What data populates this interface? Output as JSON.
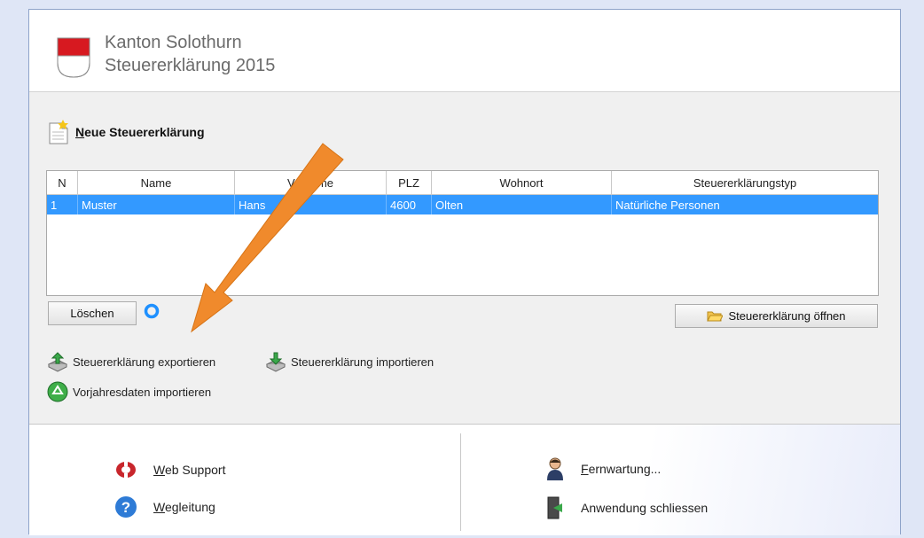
{
  "header": {
    "title_line1": "Kanton Solothurn",
    "title_line2": "Steuererklärung 2015"
  },
  "new_tax_return_label": "Neue Steuererklärung",
  "table": {
    "columns": [
      "N",
      "Name",
      "Vorname",
      "PLZ",
      "Wohnort",
      "Steuererklärungstyp"
    ],
    "rows": [
      [
        "1",
        "Muster",
        "Hans",
        "4600",
        "Olten",
        "Natürliche Personen"
      ]
    ]
  },
  "buttons": {
    "delete": "Löschen",
    "open": "Steuererklärung öffnen"
  },
  "actions": {
    "export": "Steuererklärung exportieren",
    "import": "Steuererklärung importieren",
    "previous_year": "Vorjahresdaten importieren"
  },
  "footer": {
    "web_support": "Web Support",
    "guide": "Wegleitung",
    "remote": "Fernwartung...",
    "close_app": "Anwendung schliessen"
  },
  "colors": {
    "selection": "#3399ff",
    "arrow": "#f08a2c",
    "canton_red": "#d71920"
  },
  "icons": [
    "canton-logo",
    "new-document-icon",
    "spinner-icon",
    "folder-icon",
    "export-icon",
    "import-icon",
    "recycle-icon",
    "lifebuoy-icon",
    "help-icon",
    "person-icon",
    "exit-door-icon"
  ]
}
